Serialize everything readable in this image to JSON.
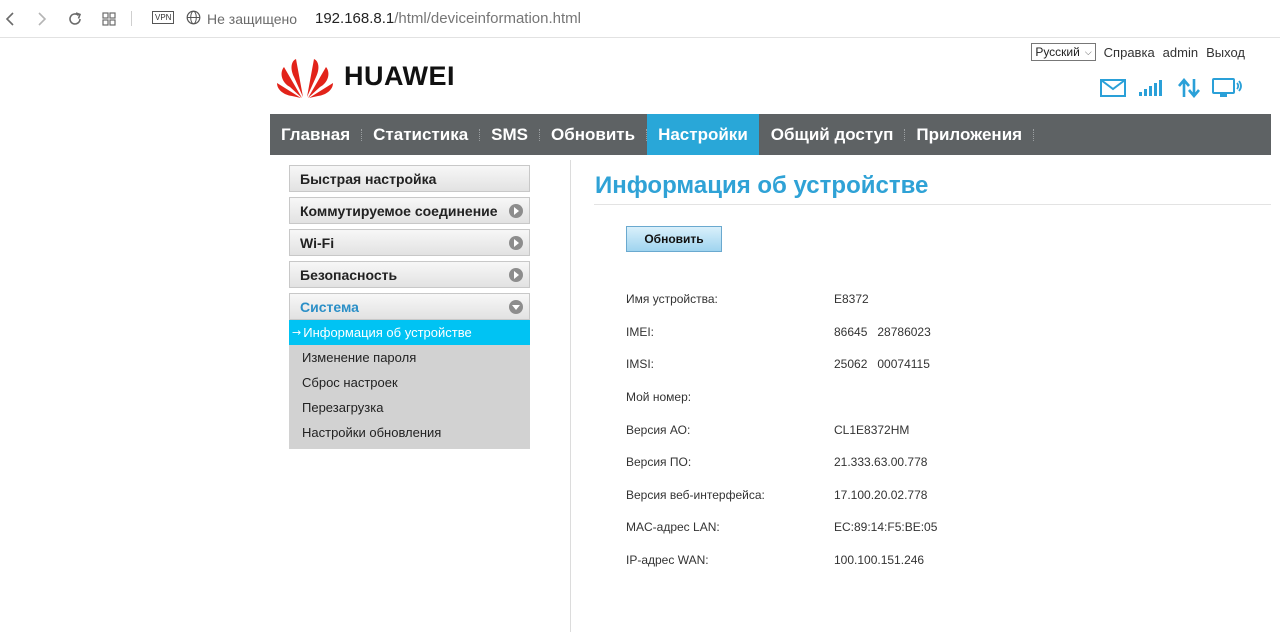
{
  "browser": {
    "vpn_label": "VPN",
    "security_text": "Не защищено",
    "url_host": "192.168.8.1",
    "url_path": "/html/deviceinformation.html"
  },
  "header": {
    "language": "Русский",
    "help": "Справка",
    "user": "admin",
    "logout": "Выход",
    "logo_text": "HUAWEI",
    "brand_color": "#e2231a"
  },
  "menu": {
    "items": [
      {
        "label": "Главная"
      },
      {
        "label": "Статистика"
      },
      {
        "label": "SMS"
      },
      {
        "label": "Обновить"
      },
      {
        "label": "Настройки",
        "active": true
      },
      {
        "label": "Общий доступ"
      },
      {
        "label": "Приложения"
      }
    ],
    "bg_color": "#5e6264",
    "active_color": "#29a7d8"
  },
  "sidebar": {
    "sections": [
      {
        "label": "Быстрая настройка"
      },
      {
        "label": "Коммутируемое соединение"
      },
      {
        "label": "Wi-Fi"
      },
      {
        "label": "Безопасность"
      },
      {
        "label": "Система"
      }
    ],
    "system_items": [
      {
        "label": "Информация об устройстве",
        "active": true
      },
      {
        "label": "Изменение пароля"
      },
      {
        "label": "Сброс настроек"
      },
      {
        "label": "Перезагрузка"
      },
      {
        "label": "Настройки обновления"
      }
    ],
    "active_arrow": "→"
  },
  "content": {
    "title": "Информация об устройстве",
    "refresh_button": "Обновить",
    "rows": [
      {
        "label": "Имя устройства:",
        "value": "E8372"
      },
      {
        "label": "IMEI:",
        "value": "86645   28786023"
      },
      {
        "label": "IMSI:",
        "value": "25062   00074115"
      },
      {
        "label": "Мой номер:",
        "value": ""
      },
      {
        "label": "Версия АО:",
        "value": "CL1E8372HM"
      },
      {
        "label": "Версия ПО:",
        "value": "21.333.63.00.778"
      },
      {
        "label": "Версия веб-интерфейса:",
        "value": "17.100.20.02.778"
      },
      {
        "label": "MAC-адрес LAN:",
        "value": "EC:89:14:F5:BE:05"
      },
      {
        "label": "IP-адрес WAN:",
        "value": "100.100.151.246"
      }
    ]
  },
  "icons": [
    "back-icon",
    "forward-icon",
    "reload-icon",
    "tabs-grid-icon",
    "globe-icon",
    "mail-icon",
    "signal-icon",
    "data-transfer-icon",
    "monitor-icon"
  ]
}
